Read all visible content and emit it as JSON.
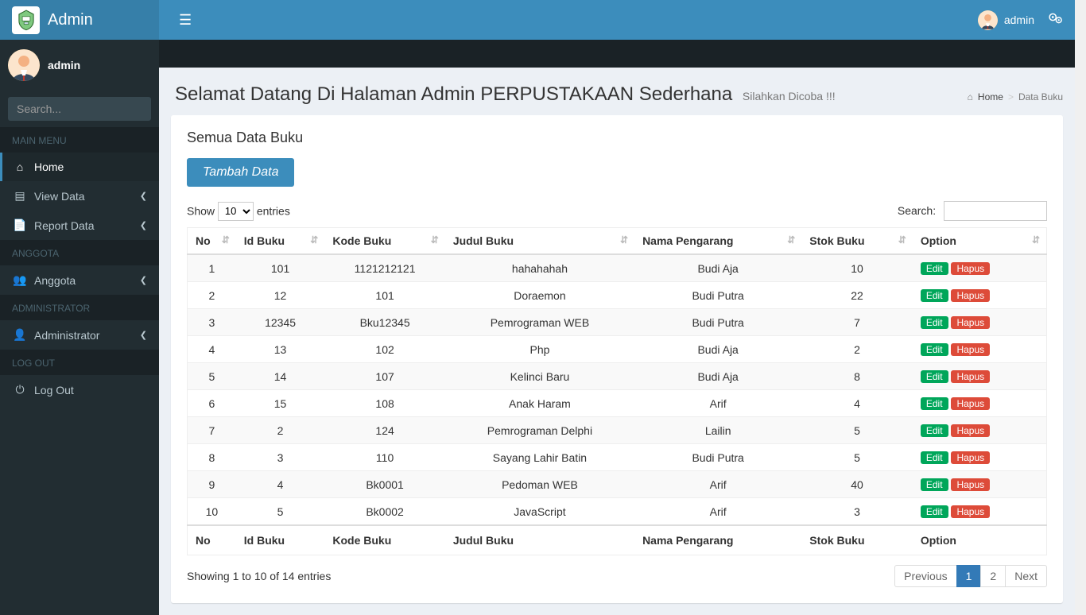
{
  "brand": "Admin",
  "navbar": {
    "username": "admin"
  },
  "sidebar": {
    "username": "admin",
    "search_placeholder": "Search...",
    "sections": [
      {
        "header": "MAIN MENU",
        "items": [
          {
            "icon": "home",
            "label": "Home",
            "active": true,
            "expandable": false
          },
          {
            "icon": "view",
            "label": "View Data",
            "active": false,
            "expandable": true
          },
          {
            "icon": "report",
            "label": "Report Data",
            "active": false,
            "expandable": true
          }
        ]
      },
      {
        "header": "ANGGOTA",
        "items": [
          {
            "icon": "users",
            "label": "Anggota",
            "active": false,
            "expandable": true
          }
        ]
      },
      {
        "header": "ADMINISTRATOR",
        "items": [
          {
            "icon": "user",
            "label": "Administrator",
            "active": false,
            "expandable": true
          }
        ]
      },
      {
        "header": "LOG OUT",
        "items": [
          {
            "icon": "power",
            "label": "Log Out",
            "active": false,
            "expandable": false
          }
        ]
      }
    ]
  },
  "page": {
    "title": "Selamat Datang Di Halaman Admin PERPUSTAKAAN Sederhana",
    "subtitle": "Silahkan Dicoba !!!",
    "breadcrumb": {
      "home": "Home",
      "current": "Data Buku"
    }
  },
  "box": {
    "title": "Semua Data Buku",
    "add_button": "Tambah Data"
  },
  "datatable": {
    "length_menu": {
      "prefix": "Show",
      "value": "10",
      "suffix": "entries"
    },
    "search_label": "Search:",
    "columns": [
      "No",
      "Id Buku",
      "Kode Buku",
      "Judul Buku",
      "Nama Pengarang",
      "Stok Buku",
      "Option"
    ],
    "rows": [
      {
        "no": 1,
        "id_buku": "101",
        "kode": "1121212121",
        "judul": "hahahahah",
        "pengarang": "Budi Aja",
        "stok": 10
      },
      {
        "no": 2,
        "id_buku": "12",
        "kode": "101",
        "judul": "Doraemon",
        "pengarang": "Budi Putra",
        "stok": 22
      },
      {
        "no": 3,
        "id_buku": "12345",
        "kode": "Bku12345",
        "judul": "Pemrograman WEB",
        "pengarang": "Budi Putra",
        "stok": 7
      },
      {
        "no": 4,
        "id_buku": "13",
        "kode": "102",
        "judul": "Php",
        "pengarang": "Budi Aja",
        "stok": 2
      },
      {
        "no": 5,
        "id_buku": "14",
        "kode": "107",
        "judul": "Kelinci Baru",
        "pengarang": "Budi Aja",
        "stok": 8
      },
      {
        "no": 6,
        "id_buku": "15",
        "kode": "108",
        "judul": "Anak Haram",
        "pengarang": "Arif",
        "stok": 4
      },
      {
        "no": 7,
        "id_buku": "2",
        "kode": "124",
        "judul": "Pemrograman Delphi",
        "pengarang": "Lailin",
        "stok": 5
      },
      {
        "no": 8,
        "id_buku": "3",
        "kode": "110",
        "judul": "Sayang Lahir Batin",
        "pengarang": "Budi Putra",
        "stok": 5
      },
      {
        "no": 9,
        "id_buku": "4",
        "kode": "Bk0001",
        "judul": "Pedoman WEB",
        "pengarang": "Arif",
        "stok": 40
      },
      {
        "no": 10,
        "id_buku": "5",
        "kode": "Bk0002",
        "judul": "JavaScript",
        "pengarang": "Arif",
        "stok": 3
      }
    ],
    "info": "Showing 1 to 10 of 14 entries",
    "pagination": {
      "previous": "Previous",
      "pages": [
        "1",
        "2"
      ],
      "active": "1",
      "next": "Next"
    },
    "row_buttons": {
      "edit": "Edit",
      "hapus": "Hapus"
    }
  }
}
